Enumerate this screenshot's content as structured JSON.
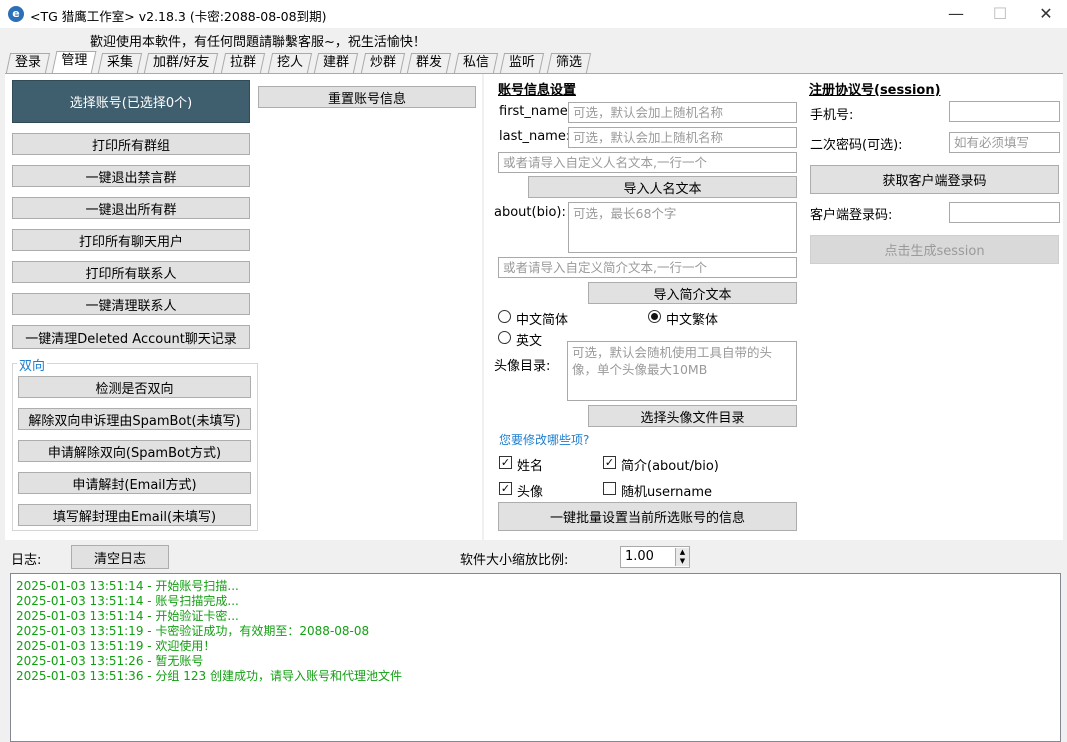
{
  "titlebar": {
    "app_icon": "app-logo-icon",
    "title": "<TG 猎鹰工作室> v2.18.3 (卡密:2088-08-08到期)",
    "minimize": "—",
    "maximize": "☐",
    "close": "✕"
  },
  "welcome": "歡迎使用本軟件，有任何問題請聯繫客服~，祝生活愉快！",
  "tabs": [
    {
      "label": "登录"
    },
    {
      "label": "管理"
    },
    {
      "label": "采集"
    },
    {
      "label": "加群/好友"
    },
    {
      "label": "拉群"
    },
    {
      "label": "挖人"
    },
    {
      "label": "建群"
    },
    {
      "label": "炒群"
    },
    {
      "label": "群发"
    },
    {
      "label": "私信"
    },
    {
      "label": "监听"
    },
    {
      "label": "筛选"
    }
  ],
  "active_tab": "管理",
  "left": {
    "select_account": "选择账号(已选择0个)",
    "reset_account": "重置账号信息",
    "buttons": [
      "打印所有群组",
      "一键退出禁言群",
      "一键退出所有群",
      "打印所有聊天用户",
      "打印所有联系人",
      "一键清理联系人",
      "一键清理Deleted Account聊天记录"
    ],
    "two_way": {
      "title": "双向",
      "buttons": [
        "检测是否双向",
        "解除双向申诉理由SpamBot(未填写)",
        "申请解除双向(SpamBot方式)",
        "申请解封(Email方式)",
        "填写解封理由Email(未填写)"
      ]
    }
  },
  "account_info": {
    "heading": "账号信息设置",
    "first_name_label": "first_name:",
    "first_name_placeholder": "可选，默认会加上随机名称",
    "last_name_label": "last_name:",
    "last_name_placeholder": "可选，默认会加上随机名称",
    "custom_name_placeholder": "或者请导入自定义人名文本,一行一个",
    "import_name_button": "导入人名文本",
    "bio_label": "about(bio):",
    "bio_placeholder": "可选，最长68个字",
    "custom_bio_placeholder": "或者请导入自定义简介文本,一行一个",
    "import_bio_button": "导入简介文本",
    "lang_simplified": "中文简体",
    "lang_traditional": "中文繁体",
    "lang_english": "英文",
    "selected_language": "中文繁体",
    "avatar_label": "头像目录:",
    "avatar_placeholder": "可选，默认会随机使用工具自带的头像，单个头像最大10MB",
    "avatar_button": "选择头像文件目录",
    "modify_question": "您要修改哪些项?",
    "opt_name": "姓名",
    "opt_name_checked": true,
    "opt_bio": "简介(about/bio)",
    "opt_bio_checked": true,
    "opt_avatar": "头像",
    "opt_avatar_checked": true,
    "opt_username": "随机username",
    "opt_username_checked": false,
    "batch_button": "一键批量设置当前所选账号的信息"
  },
  "session": {
    "heading": "注册协议号(session)",
    "phone_label": "手机号:",
    "phone_value": "",
    "password_label": "二次密码(可选):",
    "password_placeholder": "如有必须填写",
    "get_code_button": "获取客户端登录码",
    "code_label": "客户端登录码:",
    "code_value": "",
    "generate_button": "点击生成session"
  },
  "log": {
    "label": "日志:",
    "clear_button": "清空日志",
    "scale_label": "软件大小缩放比例:",
    "scale_value": "1.00",
    "lines": [
      "2025-01-03 13:51:14 - 开始账号扫描...",
      "2025-01-03 13:51:14 - 账号扫描完成...",
      "2025-01-03 13:51:14 - 开始验证卡密...",
      "2025-01-03 13:51:19 - 卡密验证成功，有效期至：2088-08-08",
      "2025-01-03 13:51:19 - 欢迎使用！",
      "2025-01-03 13:51:26 - 暂无账号",
      "2025-01-03 13:51:36 - 分组 123 创建成功，请导入账号和代理池文件"
    ],
    "line_color": "#12a012"
  }
}
